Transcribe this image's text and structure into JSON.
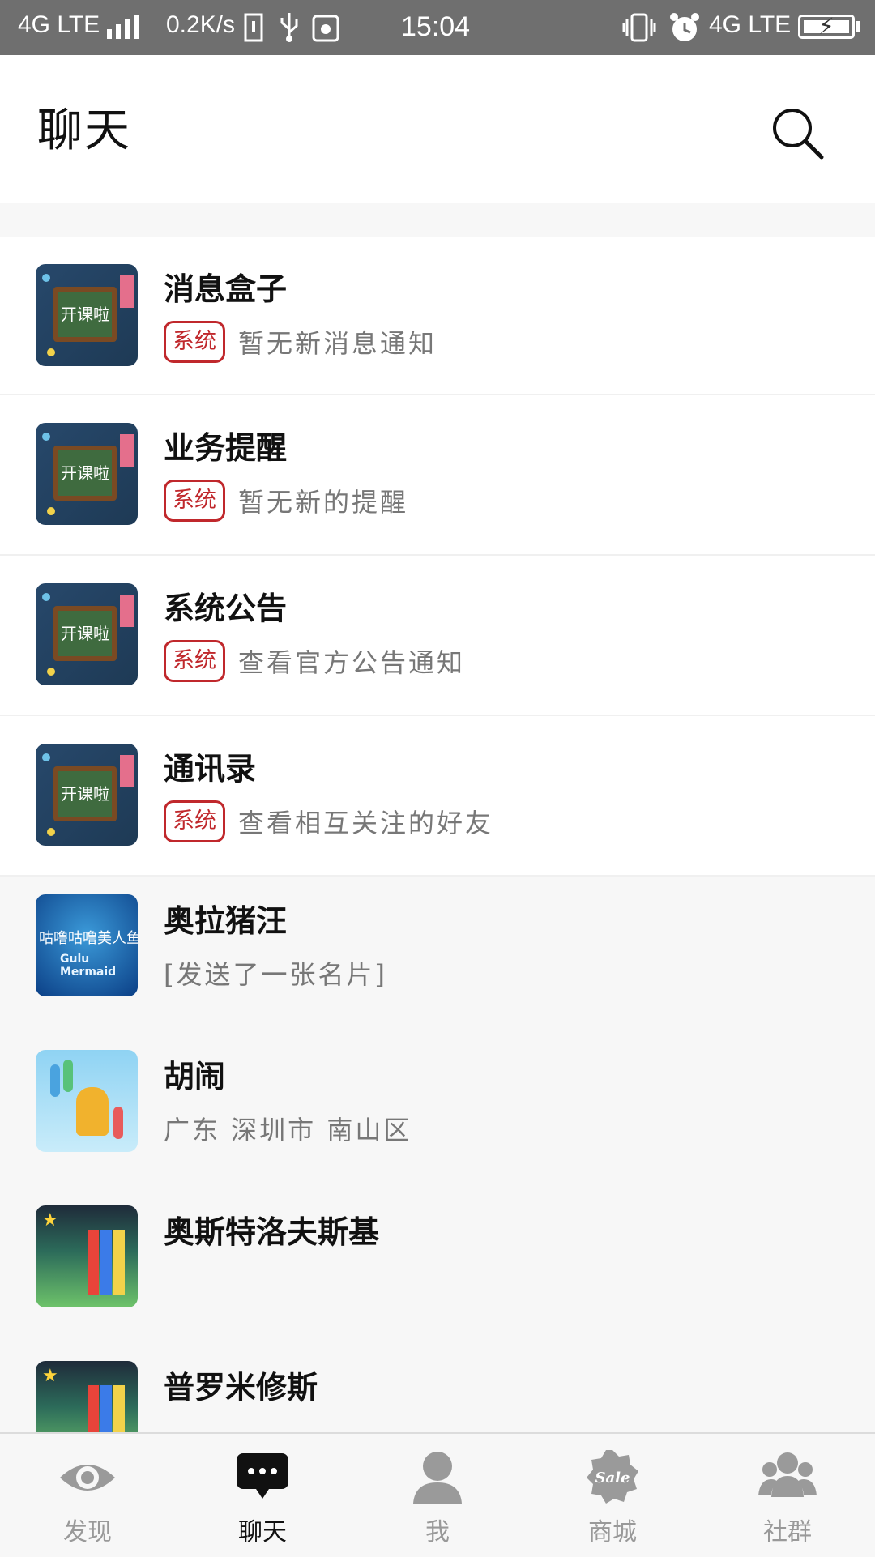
{
  "status_bar": {
    "left_text": "4G LTE",
    "speed": "0.2K/s",
    "time": "15:04",
    "right_network": "4G LTE"
  },
  "header": {
    "title": "聊天"
  },
  "system_items": [
    {
      "name": "消息盒子",
      "badge": "系统",
      "preview": "暂无新消息通知"
    },
    {
      "name": "业务提醒",
      "badge": "系统",
      "preview": "暂无新的提醒"
    },
    {
      "name": "系统公告",
      "badge": "系统",
      "preview": "查看官方公告通知"
    },
    {
      "name": "通讯录",
      "badge": "系统",
      "preview": "查看相互关注的好友"
    }
  ],
  "contacts": [
    {
      "name": "奥拉猪汪",
      "preview": "[发送了一张名片]"
    },
    {
      "name": "胡闹",
      "preview": "广东 深圳市 南山区"
    },
    {
      "name": "奥斯特洛夫斯基",
      "preview": ""
    },
    {
      "name": "普罗米修斯",
      "preview": ""
    }
  ],
  "avatar_art": {
    "board_text": "开课啦",
    "mermaid_text": "咕噜咕噜美人鱼",
    "mermaid_subtext": "Gulu Mermaid"
  },
  "tabs": [
    {
      "label": "发现",
      "icon": "eye-icon",
      "active": false
    },
    {
      "label": "聊天",
      "icon": "chat-icon",
      "active": true
    },
    {
      "label": "我",
      "icon": "person-icon",
      "active": false
    },
    {
      "label": "商城",
      "icon": "sale-icon",
      "active": false
    },
    {
      "label": "社群",
      "icon": "group-icon",
      "active": false
    }
  ],
  "colors": {
    "status_bar": "#6f6f6f",
    "badge": "#c0282c",
    "active_tab": "#111111",
    "inactive_tab": "#999999"
  }
}
